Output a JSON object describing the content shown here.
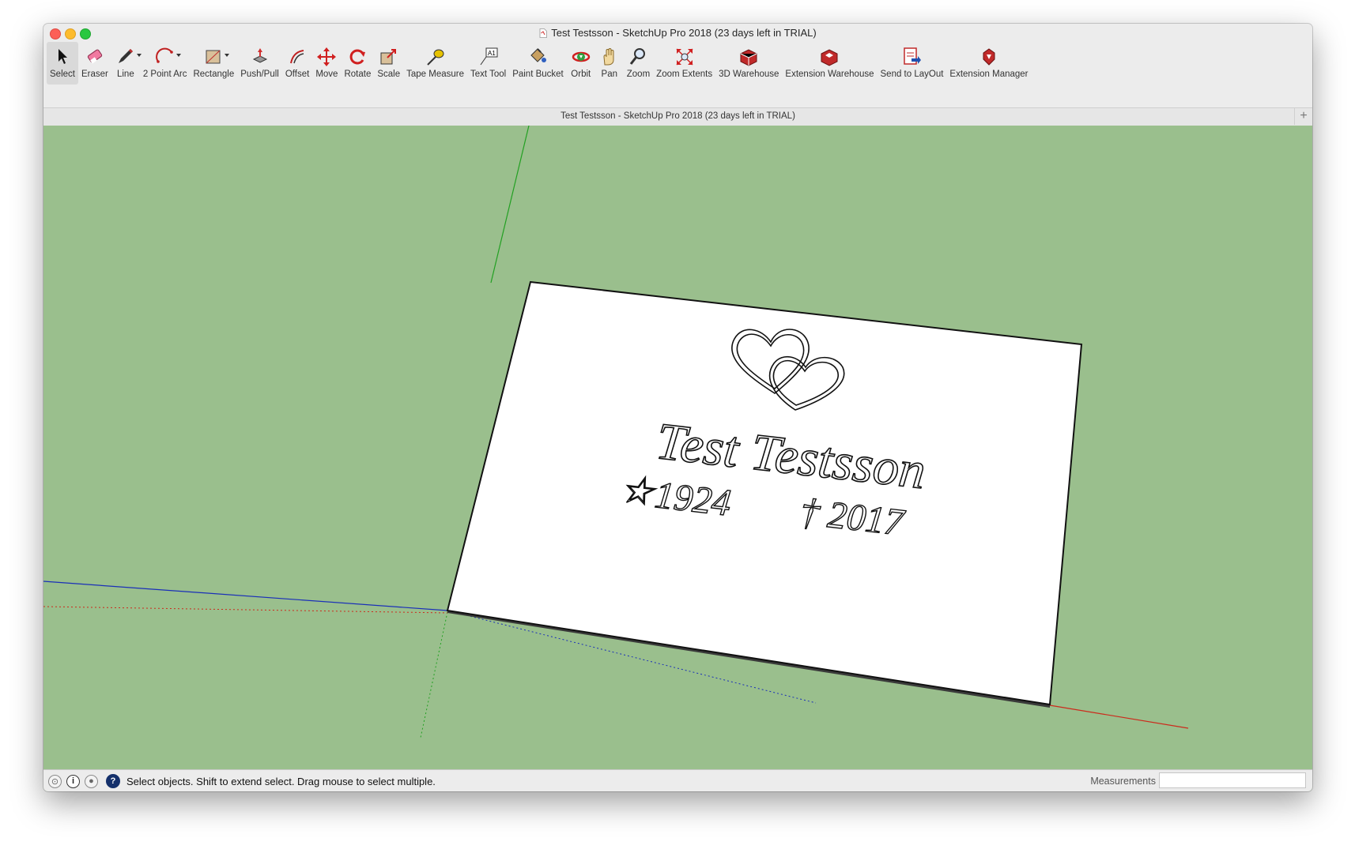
{
  "window": {
    "title": "Test Testsson - SketchUp Pro 2018 (23 days left in TRIAL)"
  },
  "toolbar": {
    "tools": [
      {
        "label": "Select",
        "icon": "select-arrow-icon",
        "selected": true
      },
      {
        "label": "Eraser",
        "icon": "eraser-icon"
      },
      {
        "label": "Line",
        "icon": "pencil-icon",
        "dropdown": true
      },
      {
        "label": "2 Point Arc",
        "icon": "arc-icon",
        "dropdown": true
      },
      {
        "label": "Rectangle",
        "icon": "rectangle-icon",
        "dropdown": true
      },
      {
        "label": "Push/Pull",
        "icon": "push-pull-icon"
      },
      {
        "label": "Offset",
        "icon": "offset-icon"
      },
      {
        "label": "Move",
        "icon": "move-icon"
      },
      {
        "label": "Rotate",
        "icon": "rotate-icon"
      },
      {
        "label": "Scale",
        "icon": "scale-icon"
      },
      {
        "label": "Tape Measure",
        "icon": "tape-measure-icon"
      },
      {
        "label": "Text Tool",
        "icon": "text-tool-icon"
      },
      {
        "label": "Paint Bucket",
        "icon": "paint-bucket-icon"
      },
      {
        "label": "Orbit",
        "icon": "orbit-icon"
      },
      {
        "label": "Pan",
        "icon": "pan-hand-icon"
      },
      {
        "label": "Zoom",
        "icon": "zoom-icon"
      },
      {
        "label": "Zoom Extents",
        "icon": "zoom-extents-icon"
      },
      {
        "label": "3D Warehouse",
        "icon": "3d-warehouse-icon"
      },
      {
        "label": "Extension Warehouse",
        "icon": "extension-warehouse-icon"
      },
      {
        "label": "Send to LayOut",
        "icon": "send-to-layout-icon"
      },
      {
        "label": "Extension Manager",
        "icon": "extension-manager-icon"
      }
    ]
  },
  "tabbar": {
    "title": "Test Testsson - SketchUp Pro 2018 (23 days left in TRIAL)"
  },
  "model": {
    "name": "Test Testsson",
    "birth": "1924",
    "death": "2017",
    "birth_symbol": "☆",
    "death_symbol": "†"
  },
  "statusbar": {
    "message": "Select objects. Shift to extend select. Drag mouse to select multiple.",
    "measurements_label": "Measurements",
    "measurements_value": ""
  },
  "colors": {
    "ground": "#9abf8d",
    "axis_red": "#cc2a1c",
    "axis_green": "#22a022",
    "axis_blue": "#1a2fb8"
  }
}
